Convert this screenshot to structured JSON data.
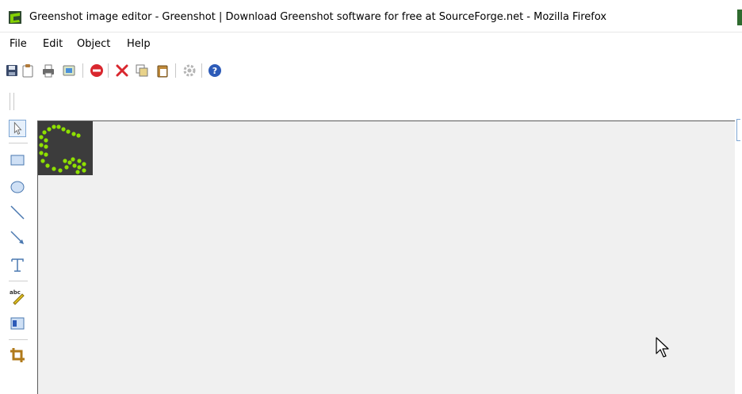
{
  "window": {
    "title": "Greenshot image editor - Greenshot | Download Greenshot software for free at SourceForge.net - Mozilla Firefox",
    "app_icon": "greenshot-logo-icon"
  },
  "menu": {
    "items": [
      "File",
      "Edit",
      "Object",
      "Help"
    ]
  },
  "toolbar": {
    "buttons": [
      "save-icon",
      "clipboard-icon",
      "print-icon",
      "email-icon",
      "close-icon",
      "delete-icon",
      "copy-icon",
      "paste-icon",
      "settings-icon",
      "help-icon"
    ]
  },
  "tools": [
    "cursor-tool-icon",
    "rectangle-tool-icon",
    "ellipse-tool-icon",
    "line-tool-icon",
    "arrow-tool-icon",
    "text-tool-icon",
    "highlight-tool-icon",
    "obfuscate-tool-icon",
    "crop-tool-icon"
  ],
  "colors": {
    "accent": "#7ea6d4",
    "canvas": "#f0f0f0",
    "thumb_bg": "#3c3c3c",
    "logo_green": "#8ee000"
  }
}
